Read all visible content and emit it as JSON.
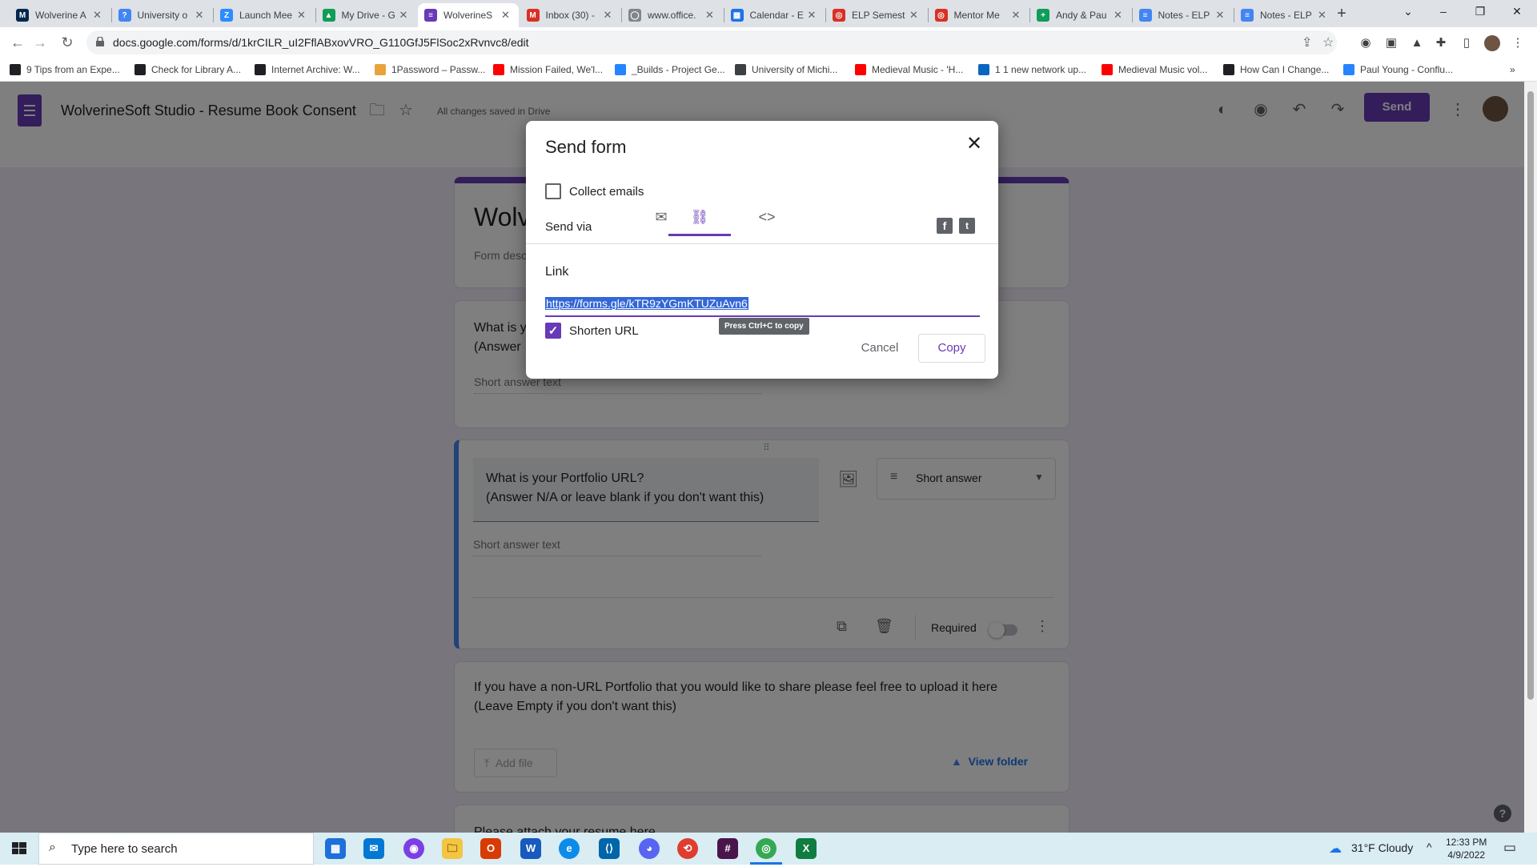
{
  "browser": {
    "tabs": [
      {
        "title": "Wolverine A",
        "icon": "M",
        "color": "#00274c",
        "active": false
      },
      {
        "title": "University o",
        "icon": "?",
        "color": "#4285f4",
        "active": false
      },
      {
        "title": "Launch Mee",
        "icon": "Z",
        "color": "#2d8cff",
        "active": false
      },
      {
        "title": "My Drive - G",
        "icon": "▲",
        "color": "#0f9d58",
        "active": false
      },
      {
        "title": "WolverineS",
        "icon": "≡",
        "color": "#673ab7",
        "active": true
      },
      {
        "title": "Inbox (30) -",
        "icon": "M",
        "color": "#d93025",
        "active": false
      },
      {
        "title": "www.office.",
        "icon": "◯",
        "color": "#80868b",
        "active": false
      },
      {
        "title": "Calendar - E",
        "icon": "▦",
        "color": "#1a73e8",
        "active": false
      },
      {
        "title": "ELP Semest",
        "icon": "◎",
        "color": "#d93025",
        "active": false
      },
      {
        "title": "Mentor Me",
        "icon": "◎",
        "color": "#d93025",
        "active": false
      },
      {
        "title": "Andy & Pau",
        "icon": "+",
        "color": "#0f9d58",
        "active": false
      },
      {
        "title": "Notes - ELP",
        "icon": "≡",
        "color": "#4285f4",
        "active": false
      },
      {
        "title": "Notes - ELP",
        "icon": "≡",
        "color": "#4285f4",
        "active": false
      }
    ],
    "url": "docs.google.com/forms/d/1krCILR_uI2FflABxovVRO_G110GfJ5FlSoc2xRvnvc8/edit",
    "bookmarks": [
      {
        "label": "9 Tips from an Expe...",
        "color": "#202124"
      },
      {
        "label": "Check for Library A...",
        "color": "#202124"
      },
      {
        "label": "Internet Archive: W...",
        "color": "#202124"
      },
      {
        "label": "1Password – Passw...",
        "color": "#e8a33d"
      },
      {
        "label": "Mission Failed, We'l...",
        "color": "#ff0000"
      },
      {
        "label": "_Builds - Project Ge...",
        "color": "#2684ff"
      },
      {
        "label": "University of Michi...",
        "color": "#3c4043"
      },
      {
        "label": "Medieval Music - 'H...",
        "color": "#ff0000"
      },
      {
        "label": "1 1 new network up...",
        "color": "#0a66c2"
      },
      {
        "label": "Medieval Music vol...",
        "color": "#ff0000"
      },
      {
        "label": "How Can I Change...",
        "color": "#202124"
      },
      {
        "label": "Paul Young - Conflu...",
        "color": "#2684ff"
      }
    ]
  },
  "app": {
    "title": "WolverineSoft Studio - Resume Book Consent",
    "save_status": "All changes saved in Drive",
    "send_label": "Send",
    "accent_color": "#673ab7"
  },
  "form": {
    "title_partial": "Wolv",
    "description_partial": "Form desc",
    "q1_partial_line1": "What is y",
    "q1_partial_line2": "(Answer",
    "q1_answer_placeholder": "Short answer text",
    "q2_line1": "What is your Portfolio URL?",
    "q2_line2": "(Answer N/A or leave blank if you don't want this)",
    "q2_type": "Short answer",
    "q2_answer_placeholder": "Short answer text",
    "q2_required_label": "Required",
    "q3_line1": "If you have a non-URL Portfolio that you would like to share please feel free to upload it here",
    "q3_line2": "(Leave Empty if you don't want this)",
    "q3_add_file": "Add file",
    "q3_view_folder": "View folder",
    "q4_partial": "Please attach your resume here"
  },
  "dialog": {
    "title": "Send form",
    "collect_emails_label": "Collect emails",
    "collect_emails_checked": false,
    "send_via_label": "Send via",
    "active_tab": "link",
    "link_label": "Link",
    "link_value": "https://forms.gle/kTR9zYGmKTUZuAvn6",
    "shorten_label": "Shorten URL",
    "shorten_checked": true,
    "tooltip": "Press Ctrl+C to copy",
    "cancel_label": "Cancel",
    "copy_label": "Copy"
  },
  "taskbar": {
    "search_placeholder": "Type here to search",
    "weather": "31°F  Cloudy",
    "time": "12:33 PM",
    "date": "4/9/2022"
  }
}
